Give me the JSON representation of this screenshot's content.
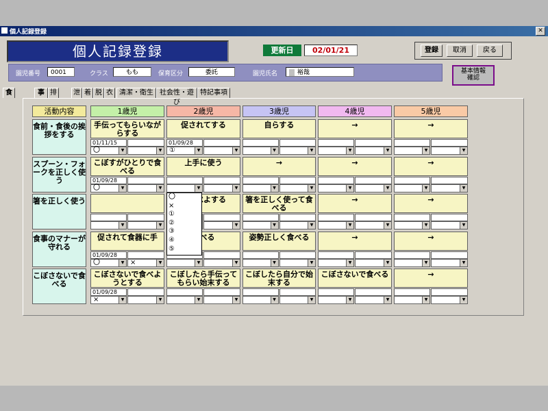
{
  "window_title": "個人記録登録",
  "close_glyph": "✕",
  "header_title": "個人記録登録",
  "update": {
    "label": "更新日",
    "value": "02/01/21"
  },
  "buttons": {
    "register": "登録",
    "cancel": "取消",
    "back": "戻る",
    "basic_info": "基本情報\n確認"
  },
  "info": {
    "school_no_label": "園児番号",
    "school_no": "0001",
    "class_label": "クラス",
    "class_value": "もも",
    "care_label": "保育区分",
    "care_value": "委託",
    "name_label": "園児氏名",
    "name_value": "裕哉"
  },
  "tabs": [
    "食",
    "事",
    "排",
    "泄",
    "着",
    "脱",
    "衣",
    "清潔・衛生",
    "社会性・遊び",
    "特記事項"
  ],
  "columns": [
    "活動内容",
    "1歳児",
    "2歳児",
    "3歳児",
    "4歳児",
    "5歳児"
  ],
  "rows": [
    {
      "label": "食前・食後の挨拶をする",
      "cells": [
        {
          "task": "手伝ってもらいながらする",
          "date": "01/11/15",
          "c1": "〇",
          "c2": ""
        },
        {
          "task": "促されてする",
          "date": "01/09/28",
          "c1": "①",
          "c2": ""
        },
        {
          "task": "自らする",
          "date": "",
          "c1": "",
          "c2": ""
        },
        {
          "task": "→",
          "date": "",
          "c1": "",
          "c2": ""
        },
        {
          "task": "→",
          "date": "",
          "c1": "",
          "c2": ""
        }
      ]
    },
    {
      "label": "スプーン・フォークを正しく使う",
      "cells": [
        {
          "task": "こぼすがひとりで食べる",
          "date": "01/09/28",
          "c1": "〇",
          "c2": ""
        },
        {
          "task": "上手に使う",
          "date": "",
          "c1": "",
          "c2": ""
        },
        {
          "task": "→",
          "date": "",
          "c1": "",
          "c2": ""
        },
        {
          "task": "→",
          "date": "",
          "c1": "",
          "c2": ""
        },
        {
          "task": "→",
          "date": "",
          "c1": "",
          "c2": ""
        }
      ]
    },
    {
      "label": "箸を正しく使う",
      "cells": [
        {
          "task": "",
          "date": "",
          "c1": "",
          "c2": ""
        },
        {
          "task": "て食べよする",
          "date": "",
          "c1": "",
          "c2": ""
        },
        {
          "task": "箸を正しく使って食べる",
          "date": "",
          "c1": "",
          "c2": ""
        },
        {
          "task": "→",
          "date": "",
          "c1": "",
          "c2": ""
        },
        {
          "task": "→",
          "date": "",
          "c1": "",
          "c2": ""
        }
      ]
    },
    {
      "label": "食事のマナーが守れる",
      "cells": [
        {
          "task": "促されて食器に手",
          "date": "01/09/28",
          "c1": "〇",
          "c2": "×"
        },
        {
          "task": "食べる",
          "date": "",
          "c1": "",
          "c2": ""
        },
        {
          "task": "姿勢正しく食べる",
          "date": "",
          "c1": "",
          "c2": ""
        },
        {
          "task": "→",
          "date": "",
          "c1": "",
          "c2": ""
        },
        {
          "task": "→",
          "date": "",
          "c1": "",
          "c2": ""
        }
      ]
    },
    {
      "label": "こぼさないで食べる",
      "cells": [
        {
          "task": "こぼさないで食べようとする",
          "date": "01/09/28",
          "c1": "×",
          "c2": ""
        },
        {
          "task": "こぼしたら手伝ってもらい始末する",
          "date": "",
          "c1": "",
          "c2": ""
        },
        {
          "task": "こぼしたら自分で始末する",
          "date": "",
          "c1": "",
          "c2": ""
        },
        {
          "task": "こぼさないで食べる",
          "date": "",
          "c1": "",
          "c2": ""
        },
        {
          "task": "→",
          "date": "",
          "c1": "",
          "c2": ""
        }
      ]
    }
  ],
  "dropdown_options": [
    "〇",
    "×",
    "①",
    "②",
    "③",
    "④",
    "⑤"
  ],
  "colors": {
    "col1": "#c4f0a8",
    "col2": "#f6b7a6",
    "col3": "#c6c4f4",
    "col4": "#f1b9f0",
    "col5": "#f9caa6",
    "label_head": "#f3ea9c",
    "task_bg": "#f7f5c4",
    "row_label_bg": "#d8f5ec"
  }
}
